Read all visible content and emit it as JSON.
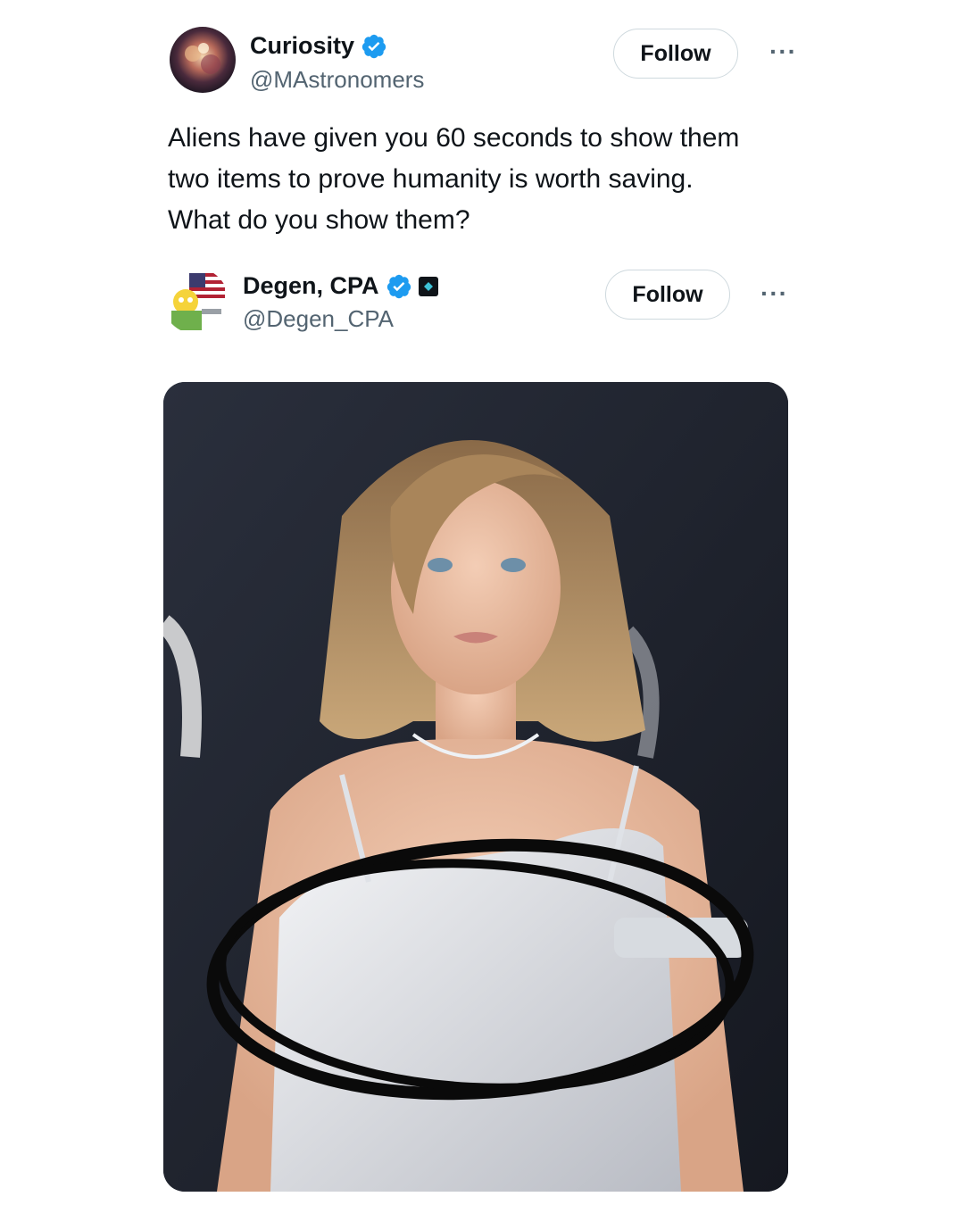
{
  "tweet": {
    "author": {
      "name": "Curiosity",
      "handle": "@MAstronomers",
      "verified": true,
      "avatar_icon": "nebula-avatar"
    },
    "follow_label": "Follow",
    "more_icon": "more-options-icon",
    "text": "Aliens have given you 60 seconds to show them\ntwo items to prove humanity is worth saving.\nWhat do you show them?"
  },
  "reply": {
    "author": {
      "name": "Degen, CPA",
      "handle": "@Degen_CPA",
      "verified": true,
      "avatar_icon": "cartoon-flag-avatar",
      "affiliate_badge_icon": "affiliate-badge-icon"
    },
    "follow_label": "Follow",
    "more_icon": "more-options-icon",
    "media": {
      "type": "photo",
      "icon": "photo-red-carpet-woman",
      "annotation": "hand-drawn black circle"
    }
  },
  "colors": {
    "verified_blue": "#1d9bf0",
    "text_primary": "#0f1419",
    "text_secondary": "#536471",
    "button_border": "#cfd9de"
  }
}
